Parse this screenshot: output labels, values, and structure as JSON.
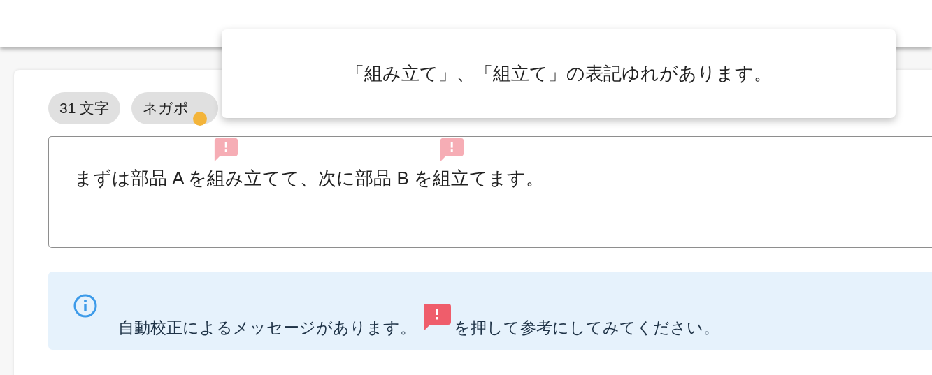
{
  "chips": [
    {
      "label": "31 文字",
      "kind": "count"
    },
    {
      "label": "ネガポ",
      "kind": "sentiment"
    }
  ],
  "editor": {
    "segments": [
      {
        "text": "まずは部品 A を",
        "flagged": false
      },
      {
        "text": "組み立て",
        "flagged": true
      },
      {
        "text": "て、次に部品 B を",
        "flagged": false
      },
      {
        "text": "組立",
        "flagged": true
      },
      {
        "text": "てます。",
        "flagged": false
      }
    ]
  },
  "info": {
    "before": "自動校正によるメッセージがあります。",
    "after": "を押して参考にしてみてください。"
  },
  "tooltip": {
    "text": "「組み立て」、「組立て」の表記ゆれがあります。"
  }
}
